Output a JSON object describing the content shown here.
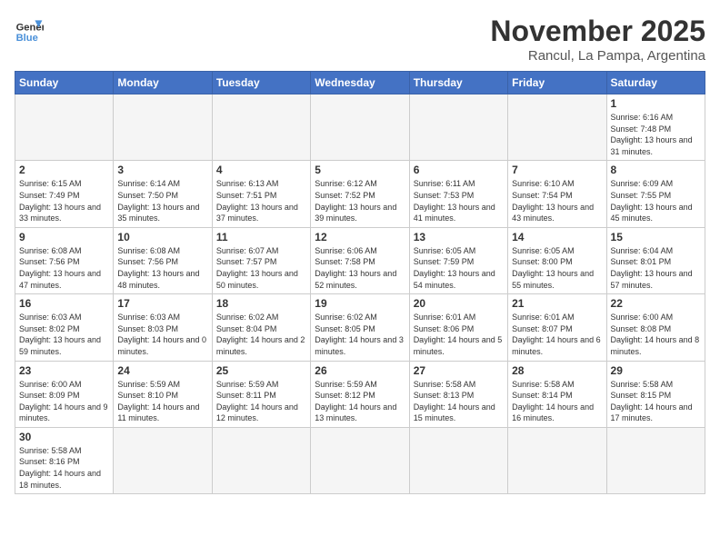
{
  "logo": {
    "general": "General",
    "blue": "Blue"
  },
  "header": {
    "month": "November 2025",
    "location": "Rancul, La Pampa, Argentina"
  },
  "weekdays": [
    "Sunday",
    "Monday",
    "Tuesday",
    "Wednesday",
    "Thursday",
    "Friday",
    "Saturday"
  ],
  "weeks": [
    [
      {
        "day": "",
        "info": ""
      },
      {
        "day": "",
        "info": ""
      },
      {
        "day": "",
        "info": ""
      },
      {
        "day": "",
        "info": ""
      },
      {
        "day": "",
        "info": ""
      },
      {
        "day": "",
        "info": ""
      },
      {
        "day": "1",
        "info": "Sunrise: 6:16 AM\nSunset: 7:48 PM\nDaylight: 13 hours and 31 minutes."
      }
    ],
    [
      {
        "day": "2",
        "info": "Sunrise: 6:15 AM\nSunset: 7:49 PM\nDaylight: 13 hours and 33 minutes."
      },
      {
        "day": "3",
        "info": "Sunrise: 6:14 AM\nSunset: 7:50 PM\nDaylight: 13 hours and 35 minutes."
      },
      {
        "day": "4",
        "info": "Sunrise: 6:13 AM\nSunset: 7:51 PM\nDaylight: 13 hours and 37 minutes."
      },
      {
        "day": "5",
        "info": "Sunrise: 6:12 AM\nSunset: 7:52 PM\nDaylight: 13 hours and 39 minutes."
      },
      {
        "day": "6",
        "info": "Sunrise: 6:11 AM\nSunset: 7:53 PM\nDaylight: 13 hours and 41 minutes."
      },
      {
        "day": "7",
        "info": "Sunrise: 6:10 AM\nSunset: 7:54 PM\nDaylight: 13 hours and 43 minutes."
      },
      {
        "day": "8",
        "info": "Sunrise: 6:09 AM\nSunset: 7:55 PM\nDaylight: 13 hours and 45 minutes."
      }
    ],
    [
      {
        "day": "9",
        "info": "Sunrise: 6:08 AM\nSunset: 7:56 PM\nDaylight: 13 hours and 47 minutes."
      },
      {
        "day": "10",
        "info": "Sunrise: 6:08 AM\nSunset: 7:56 PM\nDaylight: 13 hours and 48 minutes."
      },
      {
        "day": "11",
        "info": "Sunrise: 6:07 AM\nSunset: 7:57 PM\nDaylight: 13 hours and 50 minutes."
      },
      {
        "day": "12",
        "info": "Sunrise: 6:06 AM\nSunset: 7:58 PM\nDaylight: 13 hours and 52 minutes."
      },
      {
        "day": "13",
        "info": "Sunrise: 6:05 AM\nSunset: 7:59 PM\nDaylight: 13 hours and 54 minutes."
      },
      {
        "day": "14",
        "info": "Sunrise: 6:05 AM\nSunset: 8:00 PM\nDaylight: 13 hours and 55 minutes."
      },
      {
        "day": "15",
        "info": "Sunrise: 6:04 AM\nSunset: 8:01 PM\nDaylight: 13 hours and 57 minutes."
      }
    ],
    [
      {
        "day": "16",
        "info": "Sunrise: 6:03 AM\nSunset: 8:02 PM\nDaylight: 13 hours and 59 minutes."
      },
      {
        "day": "17",
        "info": "Sunrise: 6:03 AM\nSunset: 8:03 PM\nDaylight: 14 hours and 0 minutes."
      },
      {
        "day": "18",
        "info": "Sunrise: 6:02 AM\nSunset: 8:04 PM\nDaylight: 14 hours and 2 minutes."
      },
      {
        "day": "19",
        "info": "Sunrise: 6:02 AM\nSunset: 8:05 PM\nDaylight: 14 hours and 3 minutes."
      },
      {
        "day": "20",
        "info": "Sunrise: 6:01 AM\nSunset: 8:06 PM\nDaylight: 14 hours and 5 minutes."
      },
      {
        "day": "21",
        "info": "Sunrise: 6:01 AM\nSunset: 8:07 PM\nDaylight: 14 hours and 6 minutes."
      },
      {
        "day": "22",
        "info": "Sunrise: 6:00 AM\nSunset: 8:08 PM\nDaylight: 14 hours and 8 minutes."
      }
    ],
    [
      {
        "day": "23",
        "info": "Sunrise: 6:00 AM\nSunset: 8:09 PM\nDaylight: 14 hours and 9 minutes."
      },
      {
        "day": "24",
        "info": "Sunrise: 5:59 AM\nSunset: 8:10 PM\nDaylight: 14 hours and 11 minutes."
      },
      {
        "day": "25",
        "info": "Sunrise: 5:59 AM\nSunset: 8:11 PM\nDaylight: 14 hours and 12 minutes."
      },
      {
        "day": "26",
        "info": "Sunrise: 5:59 AM\nSunset: 8:12 PM\nDaylight: 14 hours and 13 minutes."
      },
      {
        "day": "27",
        "info": "Sunrise: 5:58 AM\nSunset: 8:13 PM\nDaylight: 14 hours and 15 minutes."
      },
      {
        "day": "28",
        "info": "Sunrise: 5:58 AM\nSunset: 8:14 PM\nDaylight: 14 hours and 16 minutes."
      },
      {
        "day": "29",
        "info": "Sunrise: 5:58 AM\nSunset: 8:15 PM\nDaylight: 14 hours and 17 minutes."
      }
    ],
    [
      {
        "day": "30",
        "info": "Sunrise: 5:58 AM\nSunset: 8:16 PM\nDaylight: 14 hours and 18 minutes."
      },
      {
        "day": "",
        "info": ""
      },
      {
        "day": "",
        "info": ""
      },
      {
        "day": "",
        "info": ""
      },
      {
        "day": "",
        "info": ""
      },
      {
        "day": "",
        "info": ""
      },
      {
        "day": "",
        "info": ""
      }
    ]
  ]
}
